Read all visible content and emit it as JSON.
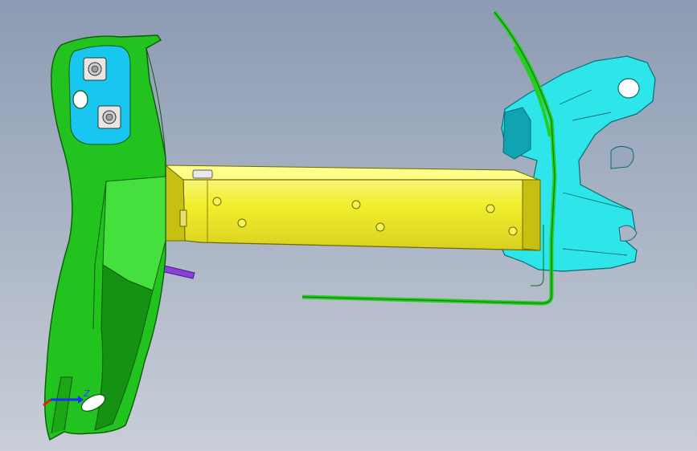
{
  "viewport": {
    "background_top": "#8c9bb3",
    "background_bottom": "#c9ced8"
  },
  "parts": {
    "left_bracket": {
      "color": "#22c21f",
      "shade": "#159214",
      "highlight": "#46e03e"
    },
    "cyan_pad": {
      "color": "#19c6ef"
    },
    "crossbeam": {
      "color": "#f2ef2e",
      "shade": "#c7c012",
      "highlight": "#ffff8a"
    },
    "right_bracket": {
      "color": "#2ee6ea",
      "shade": "#10a3b2"
    },
    "green_strip": {
      "color": "#27cc22"
    },
    "purple_tab": {
      "color": "#8a3fd6"
    }
  },
  "triad": {
    "label": "Z",
    "x_color": "#1a2cff",
    "y_color": "#1ec81e",
    "z_color": "#e81c1c"
  }
}
